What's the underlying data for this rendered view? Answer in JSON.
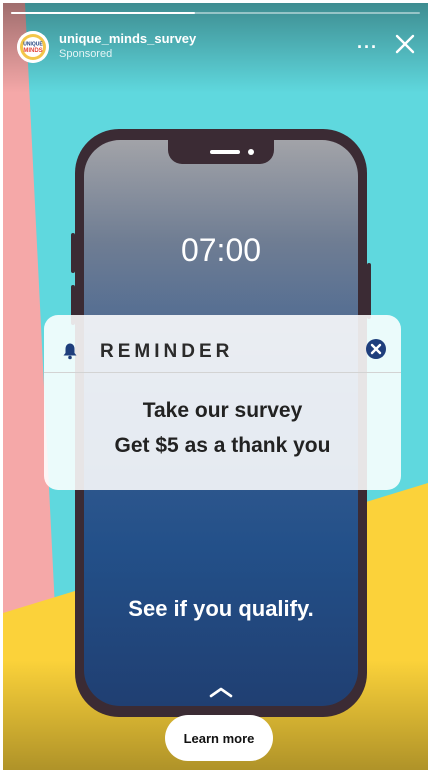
{
  "story": {
    "account_name": "unique_minds_survey",
    "sponsored_label": "Sponsored",
    "more_label": "···",
    "progress": 0.45,
    "avatar_text": {
      "line1": "UNIQUE",
      "line2": "MINDS"
    }
  },
  "phone": {
    "time": "07:00",
    "qualify_text": "See if you qualify."
  },
  "notification": {
    "title": "REMINDER",
    "line1": "Take our survey",
    "line2": "Get $5 as a thank you"
  },
  "cta": {
    "label": "Learn more"
  },
  "colors": {
    "background_teal": "#5fd8de",
    "pink_shape": "#f5a8a8",
    "yellow_shape": "#fbd23a",
    "phone_frame": "#3b2b34",
    "bell_blue": "#1e3e7c"
  },
  "icons": {
    "bell": "bell-icon",
    "close": "close-icon",
    "dismiss": "dismiss-circle-icon",
    "chevron": "chevron-up-icon"
  }
}
